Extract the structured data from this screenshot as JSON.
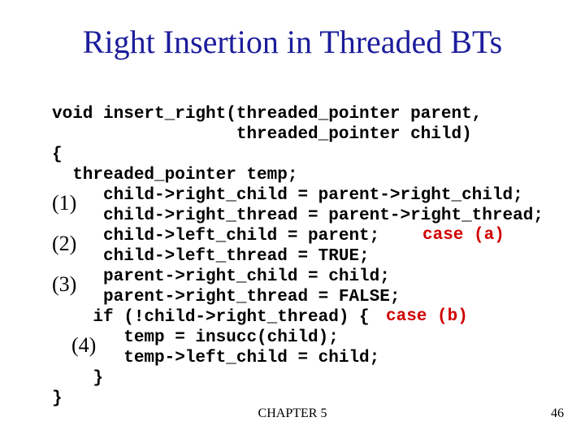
{
  "title": "Right Insertion in Threaded BTs",
  "code": {
    "l1": "void insert_right(threaded_pointer parent,",
    "l2": "                  threaded_pointer child)",
    "l3": "{",
    "l4": "  threaded_pointer temp;",
    "l5": "     child->right_child = parent->right_child;",
    "l6": "     child->right_thread = parent->right_thread;",
    "l7": "     child->left_child = parent;",
    "l8": "     child->left_thread = TRUE;",
    "l9": "     parent->right_child = child;",
    "l10": "     parent->right_thread = FALSE;",
    "l11": "    if (!child->right_thread) {",
    "l12": "       temp = insucc(child);",
    "l13": "       temp->left_child = child;",
    "l14": "    }",
    "l15": "}"
  },
  "annotations": {
    "a1": "(1)",
    "a2": "(2)",
    "a3": "(3)",
    "a4": "(4)",
    "case_a": "case (a)",
    "case_b": "case (b)"
  },
  "footer": {
    "center": "CHAPTER 5",
    "right": "46"
  }
}
